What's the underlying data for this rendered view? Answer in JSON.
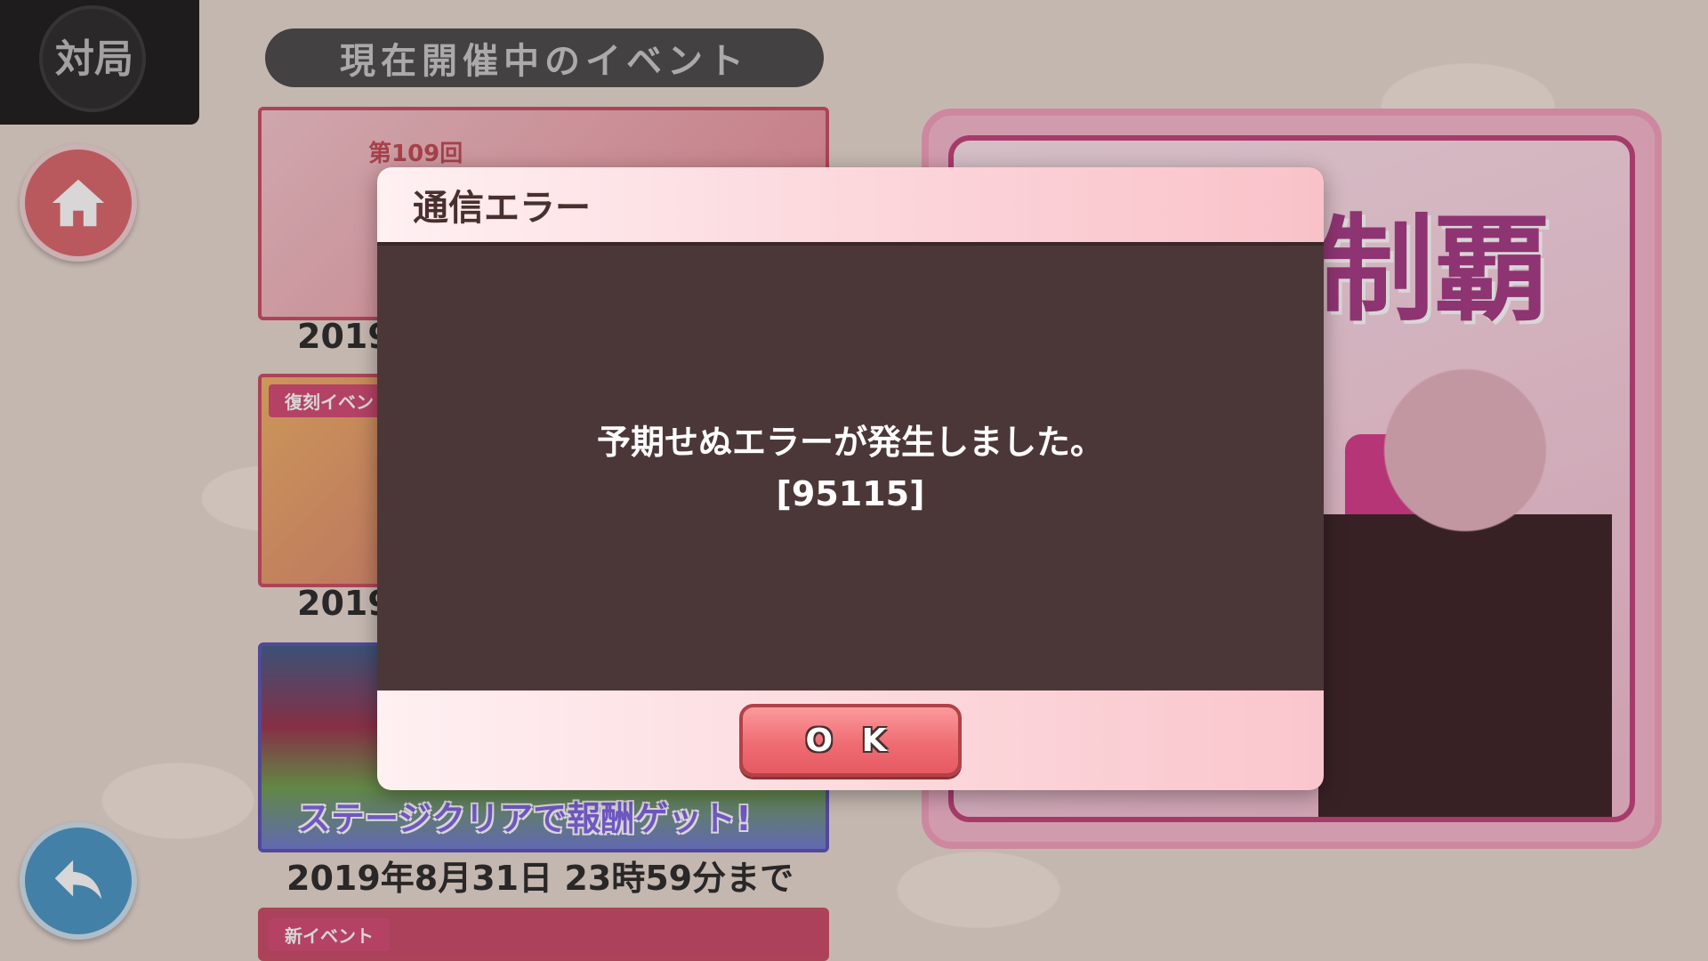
{
  "corner": {
    "label": "対局"
  },
  "header": {
    "title": "現在開催中のイベント"
  },
  "banners": [
    {
      "tag": "",
      "num": "第109回",
      "date": "2019",
      "text": ""
    },
    {
      "tag": "復刻イベント",
      "num": "",
      "date": "2019",
      "text": ""
    },
    {
      "tag": "",
      "num": "",
      "date": "2019年8月31日 23時59分まで",
      "text": "ステージクリアで報酬ゲット!"
    },
    {
      "tag": "新イベント",
      "num": "",
      "date": "",
      "text": ""
    }
  ],
  "big_banner": {
    "title": "制覇"
  },
  "dialog": {
    "title": "通信エラー",
    "message": "予期せぬエラーが発生しました。",
    "code": "[95115]",
    "ok_label": "O K"
  },
  "icons": {
    "home": "home-icon",
    "back": "back-arrow-icon"
  },
  "colors": {
    "dialog_body": "#4c3738",
    "ok_button": "#ef6d73",
    "home_button": "#d9676d",
    "back_button": "#4a97c6"
  }
}
